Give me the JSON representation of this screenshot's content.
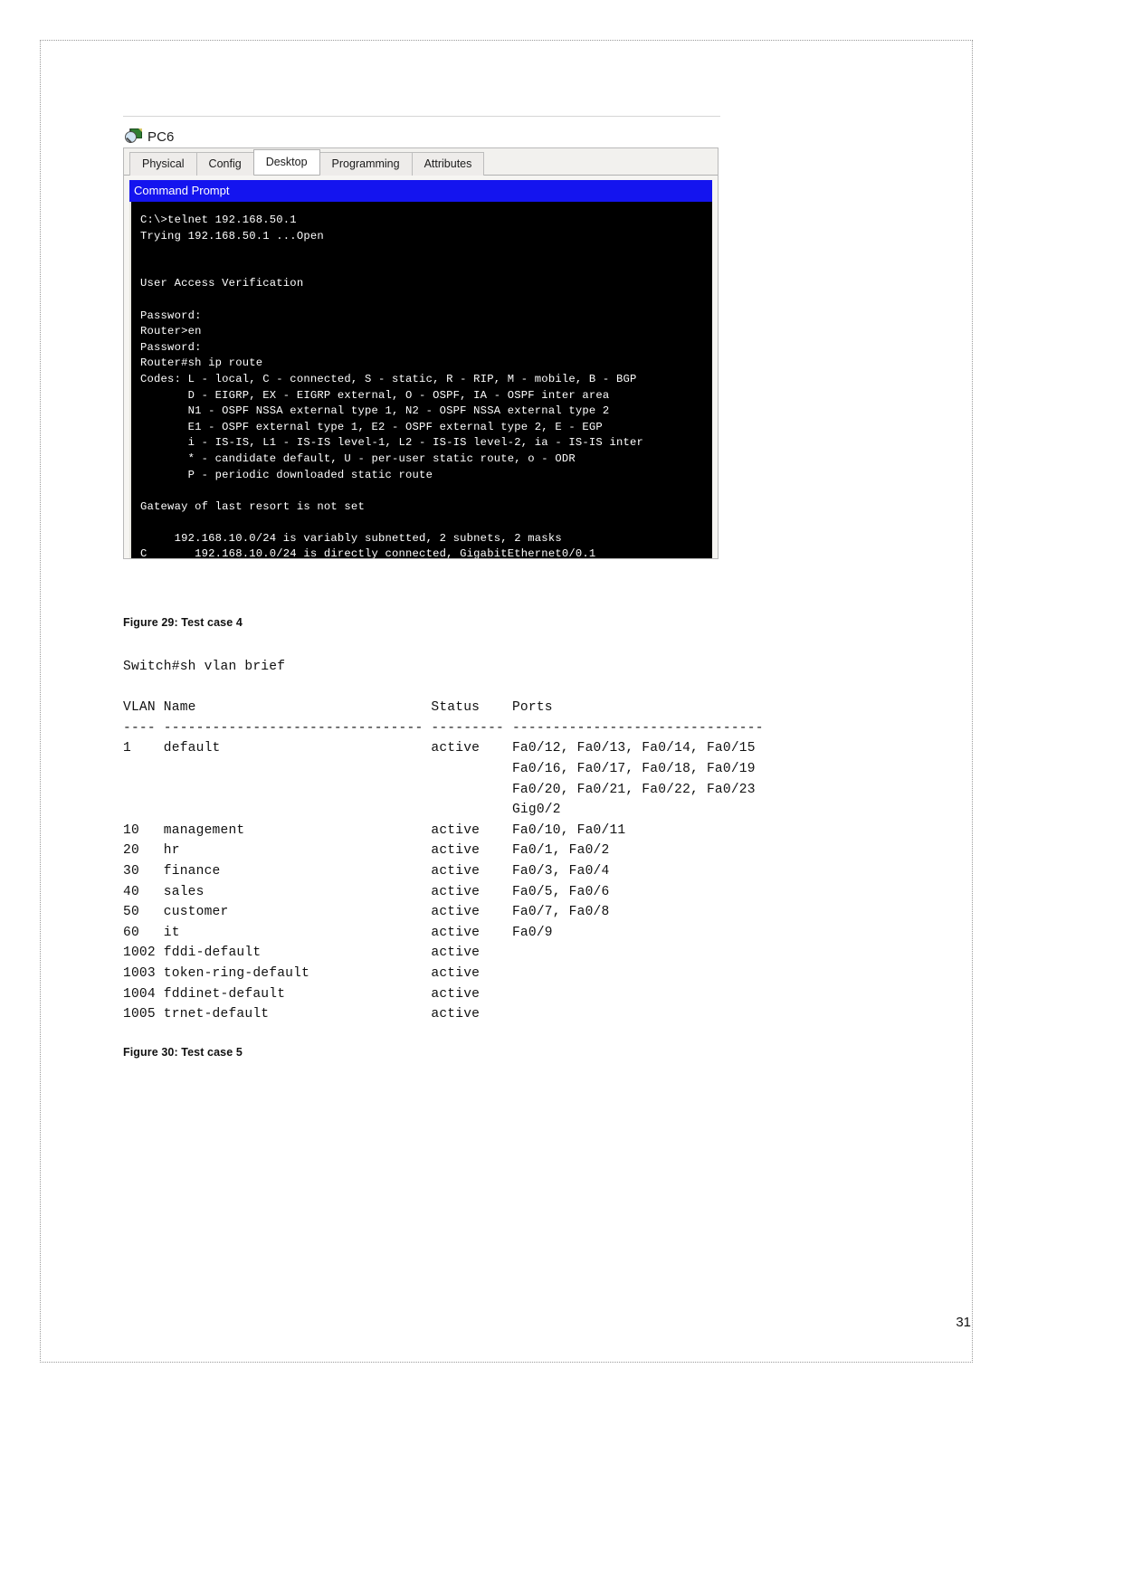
{
  "page": {
    "number": "31"
  },
  "device_window": {
    "icon": "packet-tracer-device-icon",
    "title": "PC6",
    "tabs": [
      {
        "label": "Physical",
        "active": false
      },
      {
        "label": "Config",
        "active": false
      },
      {
        "label": "Desktop",
        "active": true
      },
      {
        "label": "Programming",
        "active": false
      },
      {
        "label": "Attributes",
        "active": false
      }
    ],
    "app": {
      "titlebar": "Command Prompt",
      "titlebar_color": "#1414ef",
      "terminal_bg": "#000000",
      "terminal_fg": "#ffffff",
      "lines": [
        "C:\\>telnet 192.168.50.1",
        "Trying 192.168.50.1 ...Open",
        "",
        "",
        "User Access Verification",
        "",
        "Password:",
        "Router>en",
        "Password:",
        "Router#sh ip route",
        "Codes: L - local, C - connected, S - static, R - RIP, M - mobile, B - BGP",
        "       D - EIGRP, EX - EIGRP external, O - OSPF, IA - OSPF inter area",
        "       N1 - OSPF NSSA external type 1, N2 - OSPF NSSA external type 2",
        "       E1 - OSPF external type 1, E2 - OSPF external type 2, E - EGP",
        "       i - IS-IS, L1 - IS-IS level-1, L2 - IS-IS level-2, ia - IS-IS inter",
        "       * - candidate default, U - per-user static route, o - ODR",
        "       P - periodic downloaded static route",
        "",
        "Gateway of last resort is not set",
        "",
        "     192.168.10.0/24 is variably subnetted, 2 subnets, 2 masks",
        "C       192.168.10.0/24 is directly connected, GigabitEthernet0/0.1"
      ]
    }
  },
  "figure_29": {
    "caption": "Figure 29: Test case 4"
  },
  "figure_30": {
    "caption": "Figure 30: Test case 5"
  },
  "vlan_console": {
    "command": "Switch#sh vlan brief",
    "headers": [
      "VLAN",
      "Name",
      "Status",
      "Ports"
    ],
    "separator": "---- -------------------------------- --------- -------------------------------",
    "lines": [
      "Switch#sh vlan brief",
      "",
      "VLAN Name                             Status    Ports",
      "---- -------------------------------- --------- -------------------------------",
      "1    default                          active    Fa0/12, Fa0/13, Fa0/14, Fa0/15",
      "                                                Fa0/16, Fa0/17, Fa0/18, Fa0/19",
      "                                                Fa0/20, Fa0/21, Fa0/22, Fa0/23",
      "                                                Gig0/2",
      "10   management                       active    Fa0/10, Fa0/11",
      "20   hr                               active    Fa0/1, Fa0/2",
      "30   finance                          active    Fa0/3, Fa0/4",
      "40   sales                            active    Fa0/5, Fa0/6",
      "50   customer                         active    Fa0/7, Fa0/8",
      "60   it                               active    Fa0/9",
      "1002 fddi-default                     active",
      "1003 token-ring-default               active",
      "1004 fddinet-default                  active",
      "1005 trnet-default                    active"
    ],
    "rows": [
      {
        "vlan": "1",
        "name": "default",
        "status": "active",
        "ports": [
          "Fa0/12, Fa0/13, Fa0/14, Fa0/15",
          "Fa0/16, Fa0/17, Fa0/18, Fa0/19",
          "Fa0/20, Fa0/21, Fa0/22, Fa0/23",
          "Gig0/2"
        ]
      },
      {
        "vlan": "10",
        "name": "management",
        "status": "active",
        "ports": [
          "Fa0/10, Fa0/11"
        ]
      },
      {
        "vlan": "20",
        "name": "hr",
        "status": "active",
        "ports": [
          "Fa0/1, Fa0/2"
        ]
      },
      {
        "vlan": "30",
        "name": "finance",
        "status": "active",
        "ports": [
          "Fa0/3, Fa0/4"
        ]
      },
      {
        "vlan": "40",
        "name": "sales",
        "status": "active",
        "ports": [
          "Fa0/5, Fa0/6"
        ]
      },
      {
        "vlan": "50",
        "name": "customer",
        "status": "active",
        "ports": [
          "Fa0/7, Fa0/8"
        ]
      },
      {
        "vlan": "60",
        "name": "it",
        "status": "active",
        "ports": [
          "Fa0/9"
        ]
      },
      {
        "vlan": "1002",
        "name": "fddi-default",
        "status": "active",
        "ports": []
      },
      {
        "vlan": "1003",
        "name": "token-ring-default",
        "status": "active",
        "ports": []
      },
      {
        "vlan": "1004",
        "name": "fddinet-default",
        "status": "active",
        "ports": []
      },
      {
        "vlan": "1005",
        "name": "trnet-default",
        "status": "active",
        "ports": []
      }
    ]
  }
}
